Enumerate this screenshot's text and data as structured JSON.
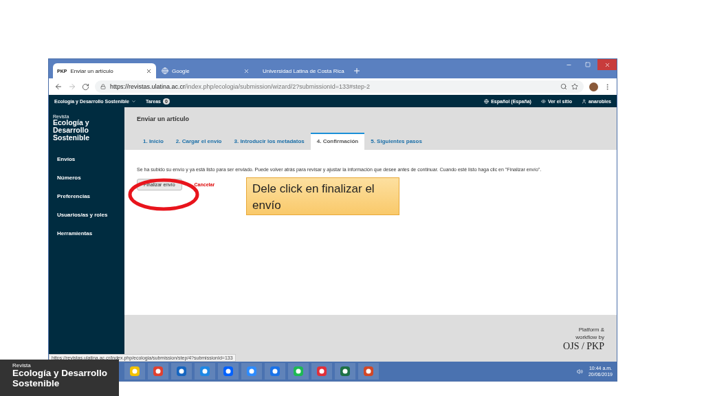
{
  "browser": {
    "tabs": [
      {
        "favicon_text": "PKP",
        "title": "Enviar un artículo",
        "selected": true
      },
      {
        "title": "Google",
        "selected": false
      },
      {
        "title": "Universidad Latina de Costa Rica",
        "selected": false
      }
    ],
    "url_host": "https://revistas.ulatina.ac.cr",
    "url_path": "/index.php/ecologia/submission/wizard/2?submissionId=133#step-2"
  },
  "ojs_bar": {
    "journal_menu": "Ecología y Desarrollo Sostenible",
    "tasks_label": "Tareas",
    "tasks_count": "0",
    "language": "Español (España)",
    "view_site": "Ver el sitio",
    "user": "anarobles"
  },
  "sidebar": {
    "kicker": "Revista",
    "journal_name": "Ecología y Desarrollo Sostenible",
    "items": [
      "Envíos",
      "Números",
      "Preferencias",
      "Usuarios/as y roles",
      "Herramientas"
    ]
  },
  "page": {
    "title": "Enviar un artículo",
    "steps": [
      {
        "label": "1. Inicio",
        "selected": false
      },
      {
        "label": "2. Cargar el envío",
        "selected": false
      },
      {
        "label": "3. Introducir los metadatos",
        "selected": false
      },
      {
        "label": "4. Confirmación",
        "selected": true
      },
      {
        "label": "5. Siguientes pasos",
        "selected": false
      }
    ],
    "message": "Se ha subido su envío y ya está listo para ser enviado. Puede volver atrás para revisar y ajustar la información que desee antes de continuar. Cuando esté listo haga clic en \"Finalizar envío\".",
    "primary_button": "Finalizar envío",
    "cancel_link": "Cancelar"
  },
  "callout": {
    "text": "Dele click en  finalizar el envío"
  },
  "footer": {
    "platform_text": "Platform & workflow by",
    "logo": "OJS / PKP"
  },
  "status_url": "https://revistas.ulatina.ac.cr/index.php/ecologia/submission/step/4?submissionId=133",
  "taskbar": {
    "time": "10:44 a.m.",
    "date": "20/06/2019"
  },
  "slide_badge": {
    "kicker": "Revista",
    "title": "Ecología y Desarrollo Sostenible"
  }
}
